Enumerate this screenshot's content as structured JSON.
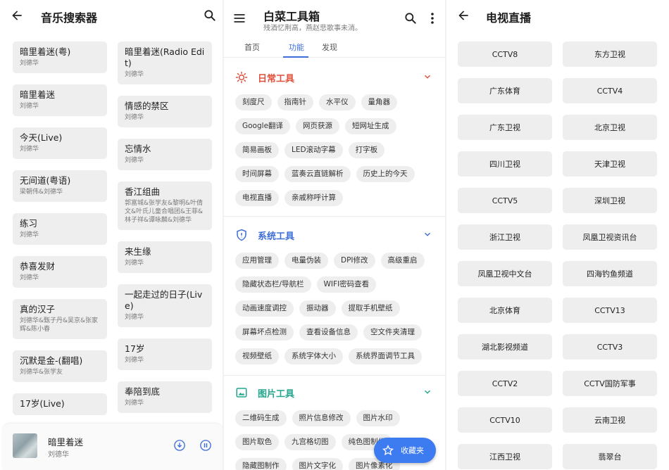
{
  "music": {
    "title": "音乐搜索器",
    "left_column": [
      {
        "name": "暗里着迷(粤)",
        "artist": "刘德华"
      },
      {
        "name": "暗里着迷",
        "artist": "刘德华"
      },
      {
        "name": "今天(Live)",
        "artist": "刘德华"
      },
      {
        "name": "无间道(粤语)",
        "artist": "梁朝伟&刘德华"
      },
      {
        "name": "练习",
        "artist": "刘德华"
      },
      {
        "name": "恭喜发财",
        "artist": "刘德华"
      },
      {
        "name": "真的汉子",
        "artist": "刘德华&甄子丹&吴京&张家辉&陈小春"
      },
      {
        "name": "沉默是金-(翻唱)",
        "artist": "刘德华&张学友"
      },
      {
        "name": "17岁(Live)",
        "artist": ""
      }
    ],
    "right_column": [
      {
        "name": "暗里着迷(Radio Edit)",
        "artist": "刘德华"
      },
      {
        "name": "情感的禁区",
        "artist": "刘德华"
      },
      {
        "name": "忘情水",
        "artist": "刘德华"
      },
      {
        "name": "香江组曲",
        "artist": "郭富城&张学友&黎明&叶倩文&叶氏儿童合唱团&王菲&林子祥&谭咏麟&刘德华"
      },
      {
        "name": "来生缘",
        "artist": "刘德华"
      },
      {
        "name": "一起走过的日子(Live)",
        "artist": "刘德华"
      },
      {
        "name": "17岁",
        "artist": "刘德华"
      },
      {
        "name": "奉陪到底",
        "artist": "刘德华"
      }
    ],
    "player": {
      "name": "暗里着迷",
      "artist": "刘德华"
    }
  },
  "toolbox": {
    "title": "白菜工具箱",
    "subtitle": "残酒忆荆高，燕赵悲歌事未消。",
    "tabs": [
      "首页",
      "功能",
      "发现"
    ],
    "active_tab": "功能",
    "sections": [
      {
        "name": "日常工具",
        "color": "#e0503a",
        "items": [
          "刻度尺",
          "指南针",
          "水平仪",
          "量角器",
          "Google翻译",
          "网页获源",
          "短网址生成",
          "简易画板",
          "LED滚动字幕",
          "打字板",
          "时间屏幕",
          "蓝奏云直链解析",
          "历史上的今天",
          "电视直播",
          "亲戚称呼计算"
        ]
      },
      {
        "name": "系统工具",
        "color": "#3e6fd8",
        "items": [
          "应用管理",
          "电量伪装",
          "DPI修改",
          "高级重启",
          "隐藏状态栏/导航栏",
          "WIFI密码查看",
          "动画速度调控",
          "振动器",
          "提取手机壁纸",
          "屏幕坏点检测",
          "查看设备信息",
          "空文件夹清理",
          "视频壁纸",
          "系统字体大小",
          "系统界面调节工具"
        ]
      },
      {
        "name": "图片工具",
        "color": "#23a58e",
        "items": [
          "二维码生成",
          "照片信息修改",
          "图片水印",
          "图片取色",
          "九宫格切图",
          "纯色图制作",
          "隐藏图制作",
          "图片文字化",
          "图片像素化"
        ]
      }
    ],
    "fab_label": "收藏夹"
  },
  "tv": {
    "title": "电视直播",
    "channels": [
      "CCTV8",
      "东方卫视",
      "广东体育",
      "CCTV4",
      "广东卫视",
      "北京卫视",
      "四川卫视",
      "天津卫视",
      "CCTV5",
      "深圳卫视",
      "浙江卫视",
      "凤凰卫视资讯台",
      "凤凰卫视中文台",
      "四海钓鱼频道",
      "北京体育",
      "CCTV13",
      "湖北影视频道",
      "CCTV3",
      "CCTV2",
      "CCTV国防军事",
      "CCTV10",
      "云南卫视",
      "江西卫视",
      "翡翠台"
    ]
  }
}
